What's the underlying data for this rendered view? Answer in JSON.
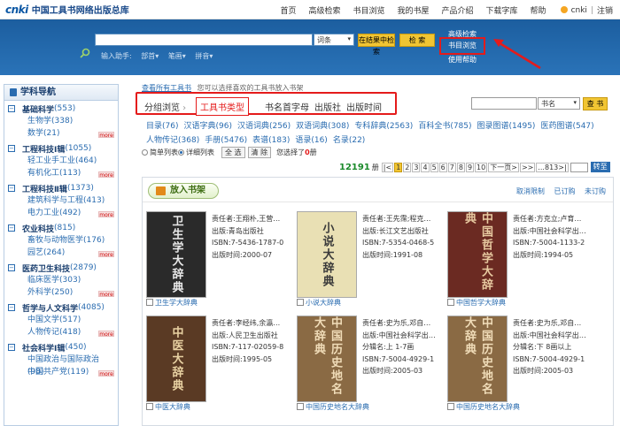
{
  "top_nav": {
    "logo_mark": "cnki",
    "logo_text": "中国工具书网络出版总库",
    "links": [
      "首页",
      "高级检索",
      "书目浏览",
      "我的书屋",
      "产品介绍",
      "下载字库",
      "帮助"
    ],
    "user": "cnki",
    "logout": "注销"
  },
  "banner": {
    "search_scope": "词条",
    "search_in_results_label": "在结果中检索",
    "search_label": "检 索",
    "advanced_search_label": "高级检索",
    "browse_label": "书目浏览",
    "help_label": "使用帮助",
    "assist_label": "输入助手:",
    "assist_items": [
      "部首▾",
      "笔画▾",
      "拼音▾"
    ]
  },
  "sidebar": {
    "title": "学科导航",
    "more_label": "more",
    "categories": [
      {
        "title": "基础科学",
        "count": "(553)",
        "subs": [
          "生物学(338)",
          "数学(21)"
        ]
      },
      {
        "title": "工程科技Ⅰ辑",
        "count": "(1055)",
        "subs": [
          "轻工业手工业(464)",
          "有机化工(113)"
        ]
      },
      {
        "title": "工程科技Ⅱ辑",
        "count": "(1373)",
        "subs": [
          "建筑科学与工程(413)",
          "电力工业(492)"
        ]
      },
      {
        "title": "农业科技",
        "count": "(815)",
        "subs": [
          "畜牧与动物医学(176)",
          "园艺(264)"
        ]
      },
      {
        "title": "医药卫生科技",
        "count": "(2879)",
        "subs": [
          "临床医学(303)",
          "外科学(250)"
        ]
      },
      {
        "title": "哲学与人文科学",
        "count": "(4085)",
        "subs": [
          "中国文学(517)",
          "人物传记(418)"
        ]
      },
      {
        "title": "社会科学Ⅰ辑",
        "count": "(450)",
        "subs": [
          "中国政治与国际政治(98)",
          "中国共产党(119)"
        ]
      }
    ]
  },
  "breadcrumb": [
    "查看所有工具书",
    "您可以选择喜欢的工具书放入书架"
  ],
  "tabs": {
    "grouped": "分组浏览",
    "type": "工具书类型",
    "initial": "书名首字母",
    "publisher": "出版社",
    "date": "出版时间"
  },
  "right_search": {
    "field": "书名",
    "button": "查 书"
  },
  "types": [
    "目录(76)",
    "汉语字典(96)",
    "汉语词典(256)",
    "双语词典(308)",
    "专科辞典(2563)",
    "百科全书(785)",
    "图录图谱(1495)",
    "医药图谱(547)",
    "人物传记(368)",
    "手册(5476)",
    "表谱(183)",
    "语录(16)",
    "名录(22)"
  ],
  "options": {
    "simple_list": "简单列表",
    "detail_list": "详细列表",
    "select_all": "全 选",
    "clear": "清 除",
    "selected_prefix": "您选择了",
    "selected_count": "0",
    "selected_suffix": "册"
  },
  "pager": {
    "total": "12191",
    "unit": "册",
    "first": "|<",
    "pages": [
      "1",
      "2",
      "3",
      "4",
      "5",
      "6",
      "7",
      "8",
      "9",
      "10"
    ],
    "current": "1",
    "next": "下一页>",
    "next_block": ">>",
    "last": "...813>|",
    "jump": "转至"
  },
  "toolbar": {
    "add_shelf": "放入书架",
    "cancel_limit": "取消限制",
    "subscribed": "已订购",
    "unsubscribed": "未订购"
  },
  "books": [
    {
      "title": "卫生学大辞典",
      "author": "责任者:王翔朴,王营…",
      "publisher": "出版:青岛出版社",
      "isbn": "ISBN:7-5436-1787-0",
      "date": "出版时间:2000-07",
      "extra": "",
      "cover_text": "卫生学大辞典",
      "cover_color": "#2a2a2a",
      "cover_fg": "#e8e8e8"
    },
    {
      "title": "小说大辞典",
      "author": "责任者:王先霈;程克…",
      "publisher": "出版:长江文艺出版社",
      "isbn": "ISBN:7-5354-0468-5",
      "date": "出版时间:1991-08",
      "extra": "",
      "cover_text": "小说大辞典",
      "cover_color": "#e9e0b4",
      "cover_fg": "#3a3a3a"
    },
    {
      "title": "中国哲学大辞典",
      "author": "责任者:方克立;卢育…",
      "publisher": "出版:中国社会科学出…",
      "isbn": "ISBN:7-5004-1133-2",
      "date": "出版时间:1994-05",
      "extra": "",
      "cover_text": "中国哲学大辞典",
      "cover_color": "#6b2a22",
      "cover_fg": "#e7c9a0"
    },
    {
      "title": "中医大辞典",
      "author": "责任者:李经纬,余瀛…",
      "publisher": "出版:人民卫生出版社",
      "isbn": "ISBN:7-117-02059-8",
      "date": "出版时间:1995-05",
      "extra": "",
      "cover_text": "中医大辞典",
      "cover_color": "#5a3a24",
      "cover_fg": "#e8d1a2"
    },
    {
      "title": "中国历史地名大辞典",
      "author": "责任者:史为乐,邓自…",
      "publisher": "出版:中国社会科学出…",
      "isbn": "ISBN:7-5004-4929-1",
      "date": "出版时间:2005-03",
      "extra": "分辑名:上 1-7画",
      "cover_text": "中国历史地名大辞典",
      "cover_color": "#8a6a44",
      "cover_fg": "#f0dcb8"
    },
    {
      "title": "中国历史地名大辞典",
      "author": "责任者:史为乐,邓自…",
      "publisher": "出版:中国社会科学出…",
      "isbn": "ISBN:7-5004-4929-1",
      "date": "出版时间:2005-03",
      "extra": "分辑名:下 8画以上",
      "cover_text": "中国历史地名大辞典",
      "cover_color": "#8a6a44",
      "cover_fg": "#f0dcb8"
    }
  ],
  "colors": {
    "banner": "#1d64a8",
    "highlight": "#e41b1b",
    "button": "#f1c533",
    "link": "#2a6cb0"
  }
}
